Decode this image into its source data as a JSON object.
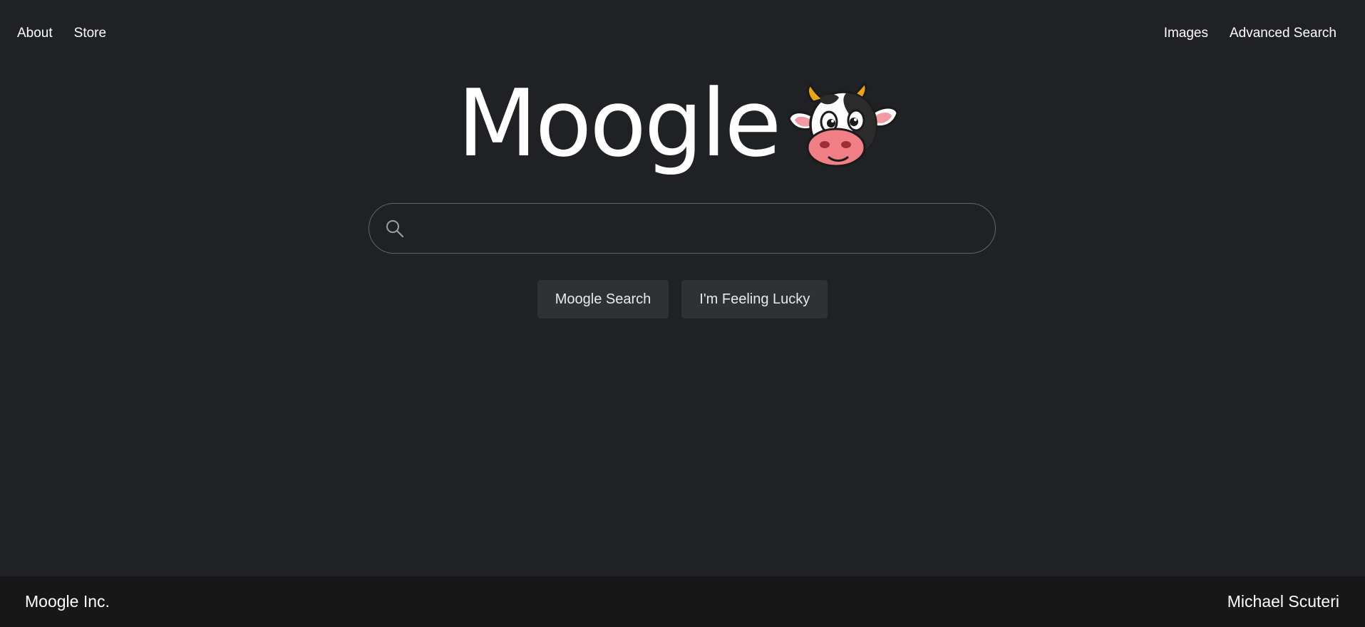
{
  "nav": {
    "left": [
      "About",
      "Store"
    ],
    "right": [
      "Images",
      "Advanced Search"
    ]
  },
  "logo": {
    "text": "Moogle",
    "mascot": "cow-mascot-icon"
  },
  "search": {
    "value": "",
    "placeholder": "",
    "icon": "search-icon"
  },
  "buttons": {
    "search_label": "Moogle Search",
    "lucky_label": "I'm Feeling Lucky"
  },
  "footer": {
    "left": "Moogle Inc.",
    "right": "Michael Scuteri"
  },
  "colors": {
    "background": "#202124",
    "footer_background": "#171717",
    "button_background": "#303134",
    "search_border": "#5f6368",
    "text": "#ffffff"
  }
}
